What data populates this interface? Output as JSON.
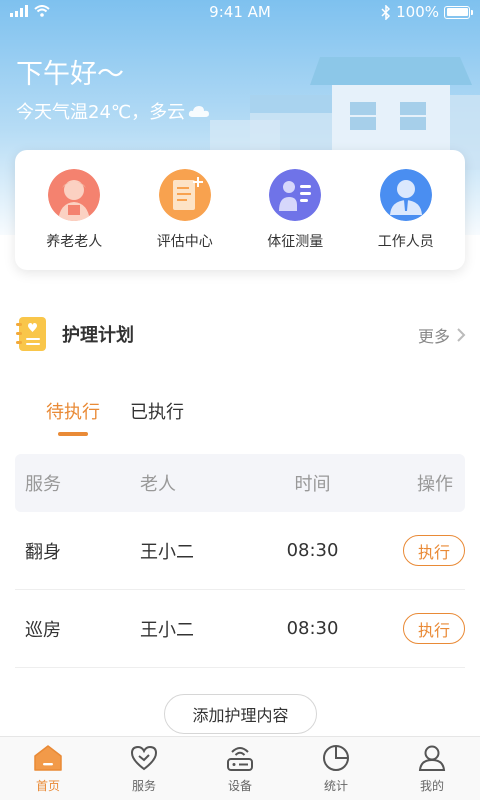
{
  "status_bar": {
    "time": "9:41 AM",
    "battery": "100%"
  },
  "header": {
    "greeting": "下午好～",
    "weather": "今天气温24℃，多云"
  },
  "quick_actions": [
    {
      "label": "养老老人",
      "icon": "elderly-person-icon"
    },
    {
      "label": "评估中心",
      "icon": "assessment-document-icon"
    },
    {
      "label": "体征测量",
      "icon": "vital-signs-icon"
    },
    {
      "label": "工作人员",
      "icon": "staff-person-icon"
    }
  ],
  "care_plan": {
    "title": "护理计划",
    "more_label": "更多",
    "tabs": [
      {
        "label": "待执行",
        "active": true
      },
      {
        "label": "已执行",
        "active": false
      }
    ],
    "columns": [
      "服务",
      "老人",
      "时间",
      "操作"
    ],
    "rows": [
      {
        "service": "翻身",
        "elder": "王小二",
        "time": "08:30",
        "action": "执行"
      },
      {
        "service": "巡房",
        "elder": "王小二",
        "time": "08:30",
        "action": "执行"
      }
    ],
    "add_button": "添加护理内容"
  },
  "tabbar": [
    {
      "label": "首页",
      "icon": "home-icon",
      "active": true
    },
    {
      "label": "服务",
      "icon": "heart-service-icon",
      "active": false
    },
    {
      "label": "设备",
      "icon": "router-device-icon",
      "active": false
    },
    {
      "label": "统计",
      "icon": "pie-chart-icon",
      "active": false
    },
    {
      "label": "我的",
      "icon": "profile-icon",
      "active": false
    }
  ],
  "colors": {
    "accent": "#e98a36",
    "sky": "#7ec1ef"
  }
}
